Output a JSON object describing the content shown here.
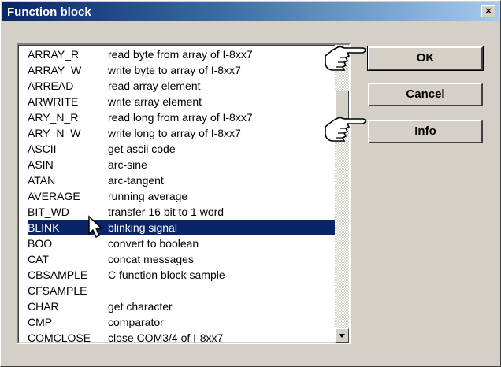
{
  "window": {
    "title": "Function block",
    "close_glyph": "×"
  },
  "list": {
    "items": [
      {
        "name": "ARRAY_R",
        "desc": "read byte from array of I-8xx7"
      },
      {
        "name": "ARRAY_W",
        "desc": "write byte to array of I-8xx7"
      },
      {
        "name": "ARREAD",
        "desc": "read array element"
      },
      {
        "name": "ARWRITE",
        "desc": "write array element"
      },
      {
        "name": "ARY_N_R",
        "desc": "read long from array of I-8xx7"
      },
      {
        "name": "ARY_N_W",
        "desc": "write long to array of I-8xx7"
      },
      {
        "name": "ASCII",
        "desc": "get ascii code"
      },
      {
        "name": "ASIN",
        "desc": "arc-sine"
      },
      {
        "name": "ATAN",
        "desc": "arc-tangent"
      },
      {
        "name": "AVERAGE",
        "desc": "running average"
      },
      {
        "name": "BIT_WD",
        "desc": "transfer 16 bit to 1 word"
      },
      {
        "name": "BLINK",
        "desc": "blinking signal"
      },
      {
        "name": "BOO",
        "desc": "convert to boolean"
      },
      {
        "name": "CAT",
        "desc": "concat messages"
      },
      {
        "name": "CBSAMPLE",
        "desc": "C function block sample"
      },
      {
        "name": "CFSAMPLE",
        "desc": ""
      },
      {
        "name": "CHAR",
        "desc": "get character"
      },
      {
        "name": "CMP",
        "desc": "comparator"
      },
      {
        "name": "COMCLOSE",
        "desc": "close COM3/4 of I-8xx7"
      }
    ],
    "selected_index": 11
  },
  "buttons": {
    "ok": "OK",
    "cancel": "Cancel",
    "info": "Info"
  },
  "colors": {
    "selection": "#0a246a",
    "title_start": "#0a246a",
    "title_end": "#a6caf0"
  },
  "icons": {
    "hand": "pointing-hand-icon",
    "cursor": "mouse-pointer-icon"
  }
}
